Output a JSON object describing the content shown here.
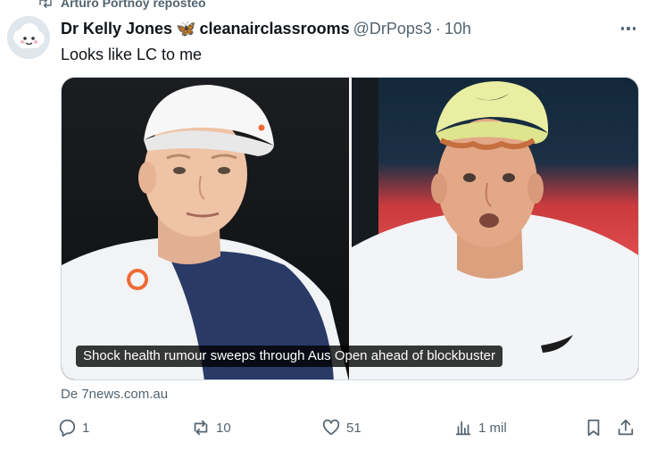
{
  "repost": {
    "text": "Arturo Portnoy reposteó",
    "icon": "repost-icon"
  },
  "tweet": {
    "author_name": "Dr Kelly Jones",
    "author_emoji": "🦋",
    "author_tag": "cleanairclassrooms",
    "handle": "@DrPops3",
    "separator": "·",
    "time": "10h",
    "text": "Looks like LC to me"
  },
  "card": {
    "caption": "Shock health rumour sweeps through Aus Open ahead of blockbuster",
    "source": "De 7news.com.au"
  },
  "actions": {
    "replies": "1",
    "reposts": "10",
    "likes": "51",
    "views": "1 mil"
  },
  "colors": {
    "text": "#0f1419",
    "secondary": "#536471",
    "border": "#cfd9de",
    "butterfly": "#1d9bf0"
  }
}
